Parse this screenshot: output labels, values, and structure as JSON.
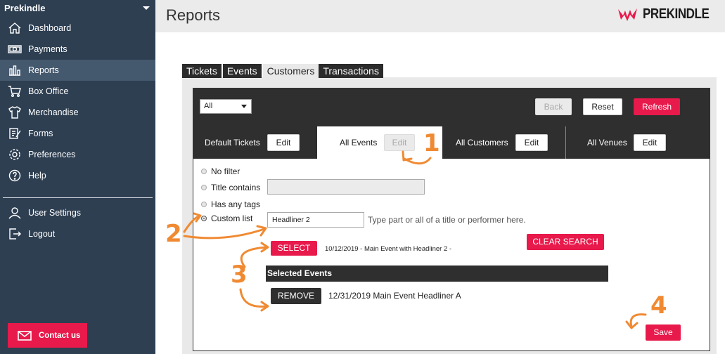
{
  "sidebar": {
    "brand": "Prekindle",
    "items": [
      {
        "label": "Dashboard",
        "icon": "home-icon"
      },
      {
        "label": "Payments",
        "icon": "money-icon"
      },
      {
        "label": "Reports",
        "icon": "bar-chart-icon",
        "active": true
      },
      {
        "label": "Box Office",
        "icon": "cart-icon"
      },
      {
        "label": "Merchandise",
        "icon": "shirt-icon"
      },
      {
        "label": "Forms",
        "icon": "form-icon"
      },
      {
        "label": "Preferences",
        "icon": "gear-icon"
      },
      {
        "label": "Help",
        "icon": "help-icon"
      }
    ],
    "bottom_items": [
      {
        "label": "User Settings",
        "icon": "user-icon"
      },
      {
        "label": "Logout",
        "icon": "logout-icon"
      }
    ],
    "contact_label": "Contact us"
  },
  "header": {
    "title": "Reports",
    "logo_text": "PREKINDLE"
  },
  "tabs": [
    {
      "label": "Tickets"
    },
    {
      "label": "Events"
    },
    {
      "label": "Customers",
      "active": true
    },
    {
      "label": "Transactions"
    }
  ],
  "toolbar": {
    "select_value": "All",
    "back_label": "Back",
    "reset_label": "Reset",
    "refresh_label": "Refresh"
  },
  "filters": {
    "default_tickets": "Default Tickets",
    "all_events": "All Events",
    "all_customers": "All Customers",
    "all_venues": "All Venues",
    "edit_label": "Edit"
  },
  "options": {
    "no_filter": "No filter",
    "title_contains": "Title contains",
    "has_any_tags": "Has any tags",
    "custom_list": "Custom list",
    "search_value": "Headliner 2",
    "search_hint": "Type part or all of a title or performer here.",
    "select_label": "SELECT",
    "result_text": "10/12/2019 - Main Event with Headliner 2 -",
    "clear_search_label": "CLEAR SEARCH",
    "selected_header": "Selected Events",
    "remove_label": "REMOVE",
    "selected_event": "12/31/2019 Main Event Headliner A",
    "save_label": "Save"
  },
  "annotations": [
    "1",
    "2",
    "3",
    "4"
  ],
  "colors": {
    "accent": "#e8194b",
    "sidebar": "#2e3f52",
    "annotation": "#f08a32"
  }
}
